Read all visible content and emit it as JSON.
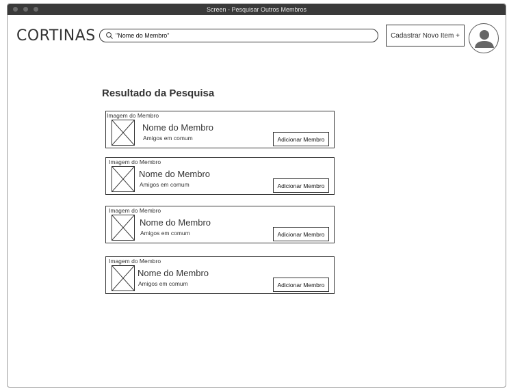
{
  "window": {
    "title": "Screen - Pesquisar Outros Membros"
  },
  "header": {
    "logo": "CORTINAS",
    "search": {
      "value": "\"Nome do Membro\"",
      "icon": "search-icon"
    },
    "add_item_label": "Cadastrar Novo Item +",
    "avatar_icon": "user-icon"
  },
  "results": {
    "title": "Resultado da Pesquisa",
    "items": [
      {
        "image_label": "Imagem do Membro",
        "name": "Nome do Membro",
        "friends": "Amigos em comum",
        "button": "Adicionar Membro"
      },
      {
        "image_label": "Imagem do Membro",
        "name": "Nome do Membro",
        "friends": "Amigos em comum",
        "button": "Adicionar Membro"
      },
      {
        "image_label": "Imagem do Membro",
        "name": "Nome do Membro",
        "friends": "Amigos em comum",
        "button": "Adicionar Membro"
      },
      {
        "image_label": "Imagem do Membro",
        "name": "Nome do Membro",
        "friends": "Amigos em comum",
        "button": "Adicionar Membro"
      }
    ]
  }
}
